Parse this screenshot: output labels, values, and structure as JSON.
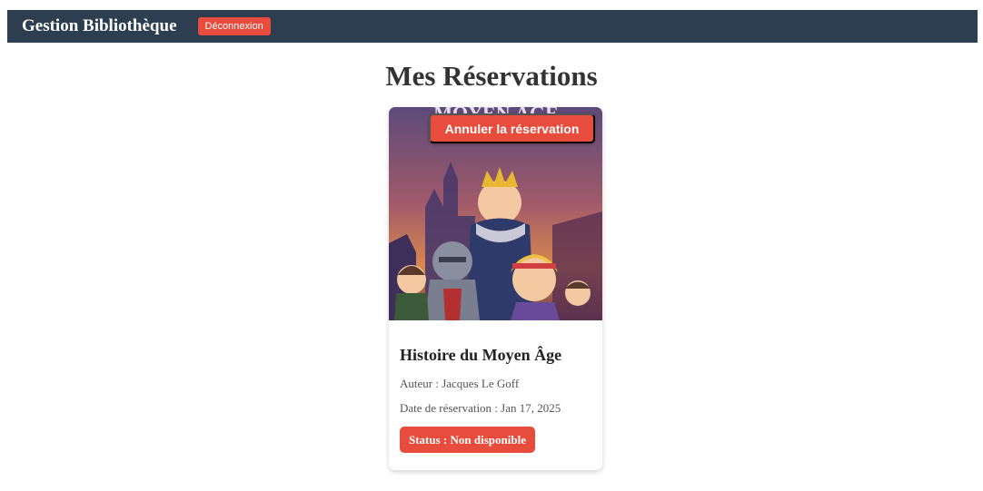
{
  "navbar": {
    "brand": "Gestion Bibliothèque",
    "logout_label": "Déconnexion"
  },
  "page": {
    "title": "Mes Réservations"
  },
  "reservation": {
    "cover_text": "MOYEN ÂGE",
    "cancel_label": "Annuler la réservation",
    "title": "Histoire du Moyen Âge",
    "author": "Auteur : Jacques Le Goff",
    "date": "Date de réservation : Jan 17, 2025",
    "status": "Status : Non disponible"
  },
  "colors": {
    "nav_bg": "#2c3e50",
    "danger": "#e74c3c"
  }
}
